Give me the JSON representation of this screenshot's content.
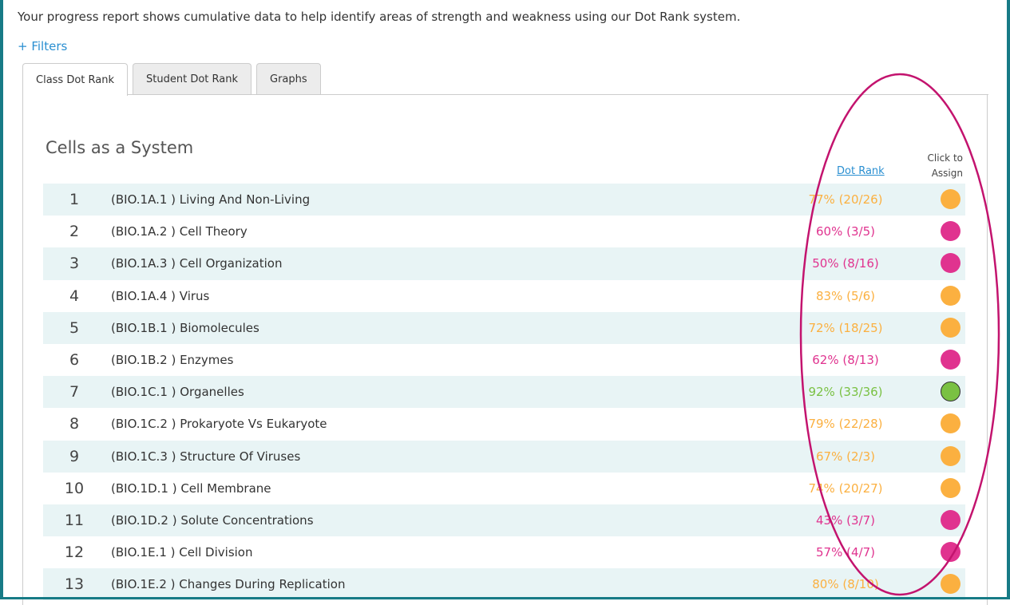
{
  "intro_text": "Your progress report shows cumulative data to help identify areas of strength and weakness using our Dot Rank system.",
  "filters_label": "+ Filters",
  "tabs": [
    {
      "label": "Class Dot Rank",
      "active": true
    },
    {
      "label": "Student Dot Rank",
      "active": false
    },
    {
      "label": "Graphs",
      "active": false
    }
  ],
  "section_title": "Cells as a System",
  "columns": {
    "dot_rank": "Dot Rank",
    "assign_line1": "Click to",
    "assign_line2": "Assign"
  },
  "colors": {
    "orange": "#fbb040",
    "pink": "#e0338f",
    "green": "#7ac143",
    "annotation": "#c3136e"
  },
  "rows": [
    {
      "num": "1",
      "topic": "(BIO.1A.1 ) Living And Non-Living",
      "score": "77% (20/26)",
      "rank": "orange"
    },
    {
      "num": "2",
      "topic": "(BIO.1A.2 ) Cell Theory",
      "score": "60% (3/5)",
      "rank": "pink"
    },
    {
      "num": "3",
      "topic": "(BIO.1A.3 ) Cell Organization",
      "score": "50% (8/16)",
      "rank": "pink"
    },
    {
      "num": "4",
      "topic": "(BIO.1A.4 ) Virus",
      "score": "83% (5/6)",
      "rank": "orange"
    },
    {
      "num": "5",
      "topic": "(BIO.1B.1 ) Biomolecules",
      "score": "72% (18/25)",
      "rank": "orange"
    },
    {
      "num": "6",
      "topic": "(BIO.1B.2 ) Enzymes",
      "score": "62% (8/13)",
      "rank": "pink"
    },
    {
      "num": "7",
      "topic": "(BIO.1C.1 ) Organelles",
      "score": "92% (33/36)",
      "rank": "green"
    },
    {
      "num": "8",
      "topic": "(BIO.1C.2 ) Prokaryote Vs Eukaryote",
      "score": "79% (22/28)",
      "rank": "orange"
    },
    {
      "num": "9",
      "topic": "(BIO.1C.3 ) Structure Of Viruses",
      "score": "67% (2/3)",
      "rank": "orange"
    },
    {
      "num": "10",
      "topic": "(BIO.1D.1 ) Cell Membrane",
      "score": "74% (20/27)",
      "rank": "orange"
    },
    {
      "num": "11",
      "topic": "(BIO.1D.2 ) Solute Concentrations",
      "score": "43% (3/7)",
      "rank": "pink"
    },
    {
      "num": "12",
      "topic": "(BIO.1E.1 ) Cell Division",
      "score": "57% (4/7)",
      "rank": "pink"
    },
    {
      "num": "13",
      "topic": "(BIO.1E.2 ) Changes During Replication",
      "score": "80% (8/10)",
      "rank": "orange"
    }
  ]
}
